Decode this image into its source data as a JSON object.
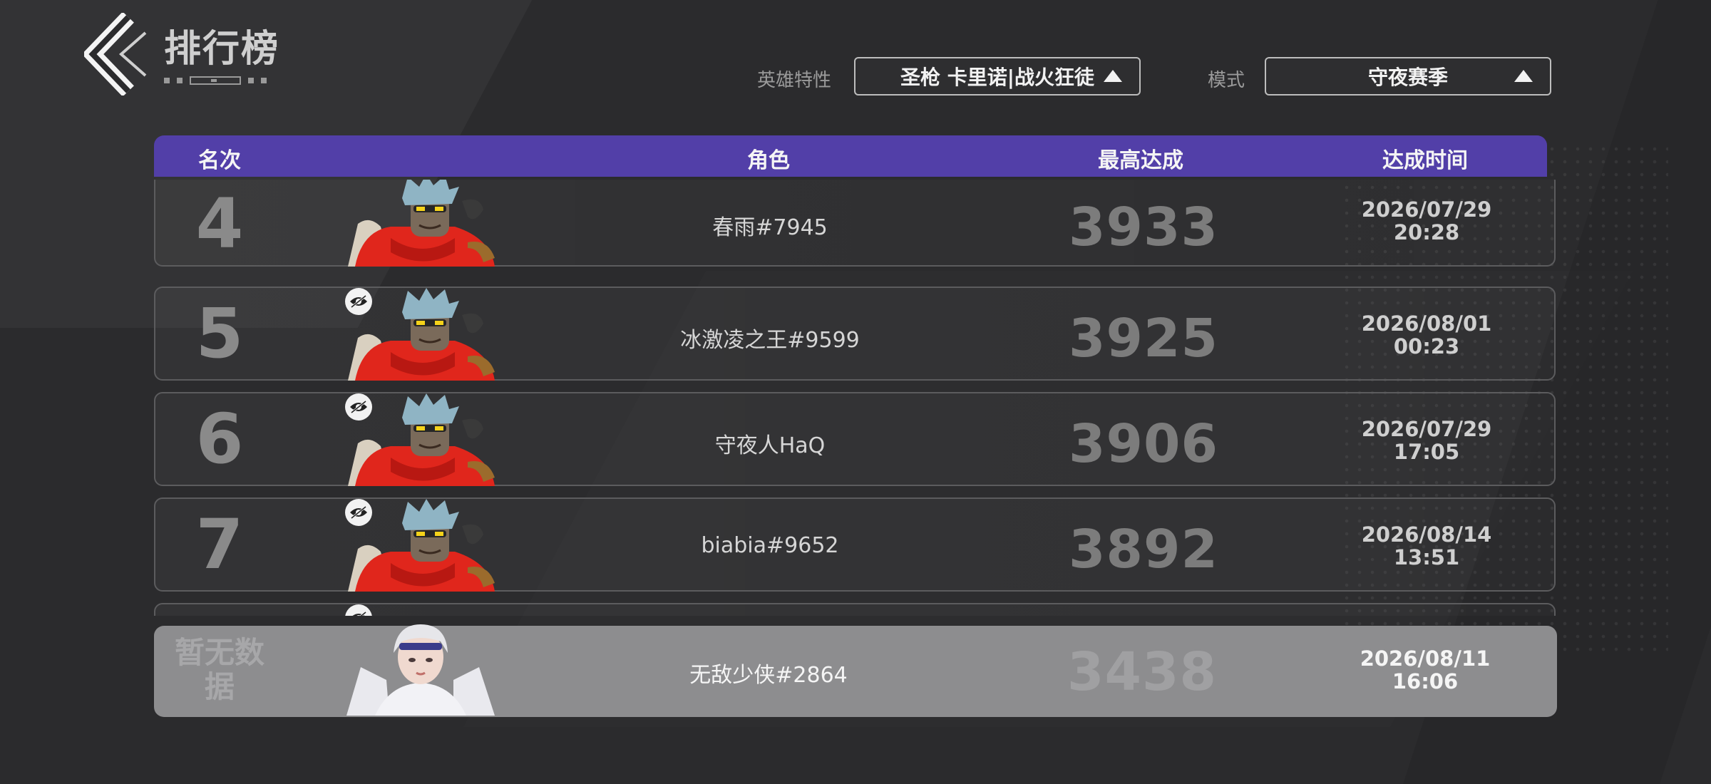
{
  "header": {
    "title": "排行榜"
  },
  "filters": {
    "hero_label": "英雄特性",
    "hero_value": "圣枪 卡里诺|战火狂徒",
    "mode_label": "模式",
    "mode_value": "守夜赛季"
  },
  "columns": {
    "rank": "名次",
    "role": "角色",
    "best": "最高达成",
    "time": "达成时间"
  },
  "rows": [
    {
      "rank": "4",
      "name": "春雨#7945",
      "score": "3933",
      "date": "2026/07/29",
      "clock": "20:28",
      "hidden": false
    },
    {
      "rank": "5",
      "name": "冰激凌之王#9599",
      "score": "3925",
      "date": "2026/08/01",
      "clock": "00:23",
      "hidden": true
    },
    {
      "rank": "6",
      "name": "守夜人HaQ",
      "score": "3906",
      "date": "2026/07/29",
      "clock": "17:05",
      "hidden": true
    },
    {
      "rank": "7",
      "name": "biabia#9652",
      "score": "3892",
      "date": "2026/08/14",
      "clock": "13:51",
      "hidden": true
    }
  ],
  "self": {
    "rank_text": "暂无数据",
    "name": "无敌少侠#2864",
    "score": "3438",
    "date": "2026/08/11",
    "clock": "16:06"
  },
  "colors": {
    "header_bar": "#523fa8",
    "self_row": "#8d8d8f",
    "background": "#2b2b2d"
  },
  "icons": {
    "back": "chevron-left-icon",
    "dropdown": "triangle-up-icon",
    "hidden": "eye-off-icon"
  }
}
